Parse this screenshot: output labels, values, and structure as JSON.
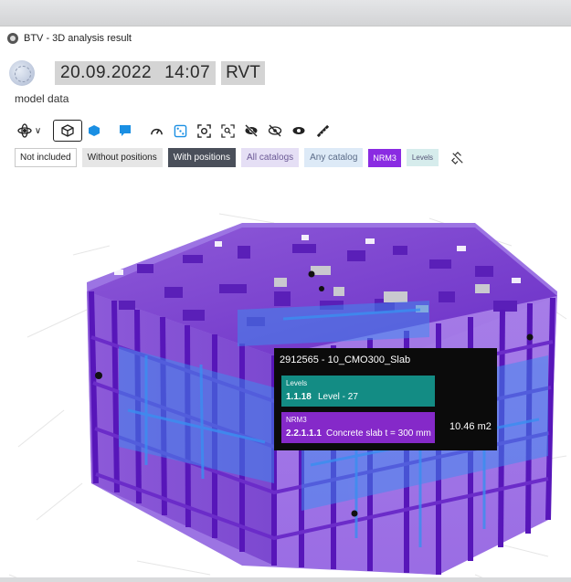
{
  "window": {
    "title": "BTV - 3D analysis result"
  },
  "header": {
    "date": "20.09.2022",
    "time": "14:07",
    "format": "RVT"
  },
  "subtitle": "model data",
  "toolbar": {
    "icons": [
      "orbit-icon",
      "cube-outline-icon",
      "cube-solid-icon",
      "comment-icon",
      "speedometer-icon",
      "dice-icon",
      "focus-icon",
      "zoom-icon",
      "hide-icon",
      "hide-outline-icon",
      "show-icon",
      "measure-icon"
    ]
  },
  "filters": {
    "not_included": "Not included",
    "without_positions": "Without positions",
    "with_positions": "With positions",
    "all_catalogs": "All catalogs",
    "any_catalog": "Any catalog",
    "nrm3": "NRM3",
    "levels": "Levels"
  },
  "tooltip": {
    "title": "2912565 - 10_CMO300_Slab",
    "levels": {
      "category": "Levels",
      "code": "1.1.18",
      "name": "Level - 27"
    },
    "nrm3": {
      "category": "NRM3",
      "code": "2.2.1.1.1",
      "name": "Concrete slab t = 300 mm"
    },
    "area": "10.46 m2"
  },
  "colors": {
    "purple": "#8a2be2",
    "teal": "#138c84",
    "blue": "#3a8ef0",
    "dark_chip": "#4a4f5a"
  }
}
